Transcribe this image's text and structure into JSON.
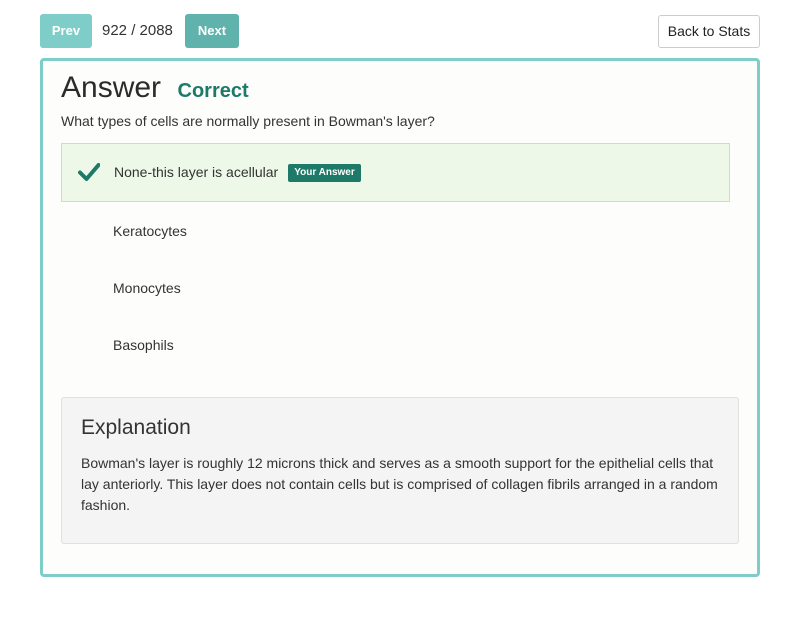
{
  "nav": {
    "prev_label": "Prev",
    "counter": "922 / 2088",
    "next_label": "Next",
    "back_label": "Back to Stats"
  },
  "answer": {
    "heading": "Answer",
    "status": "Correct",
    "question": "What types of cells are normally present in Bowman's layer?",
    "options": [
      {
        "label": "None-this layer is acellular",
        "badge": "Your Answer",
        "selected": true
      },
      {
        "label": "Keratocytes",
        "selected": false
      },
      {
        "label": "Monocytes",
        "selected": false
      },
      {
        "label": "Basophils",
        "selected": false
      }
    ]
  },
  "explanation": {
    "title": "Explanation",
    "body": "Bowman's layer is roughly 12 microns thick and serves as a smooth support for the epithelial cells that lay anteriorly. This layer does not contain cells but is comprised of collagen fibrils arranged in a random fashion."
  },
  "colors": {
    "accent": "#7fcdc9",
    "correct": "#1d7a68",
    "selected_bg": "#eef8e8"
  },
  "icons": {
    "selected_option": "check-icon"
  }
}
